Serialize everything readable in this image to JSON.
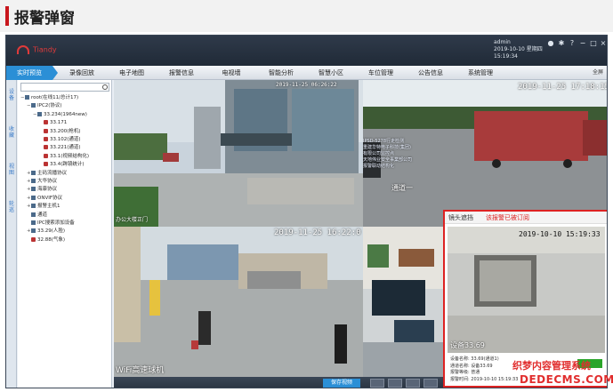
{
  "article": {
    "heading": "报警弹窗"
  },
  "app": {
    "logo_text": "Tiandy",
    "user_name": "admin",
    "date": "2019-10-10 星期四",
    "clock": "15:19:34",
    "menu": [
      {
        "label": "实时预览",
        "active": true
      },
      {
        "label": "录像回放"
      },
      {
        "label": "电子地图"
      },
      {
        "label": "报警信息"
      },
      {
        "label": "电视墙"
      },
      {
        "label": "智能分析"
      },
      {
        "label": "智慧小区"
      },
      {
        "label": "车位管理"
      },
      {
        "label": "公告信息"
      },
      {
        "label": "系统管理"
      }
    ],
    "menu_right": "全屏",
    "vtabs": [
      "设备",
      "收藏",
      "视图",
      "轮巡"
    ],
    "tree": [
      {
        "label": "root(在线11/总计17)",
        "indent": 0,
        "type": "dev",
        "exp": "−"
      },
      {
        "label": "IPC2(协议)",
        "indent": 1,
        "type": "dev",
        "exp": "−"
      },
      {
        "label": "33.234(1964new)",
        "indent": 2,
        "type": "dev",
        "exp": "−"
      },
      {
        "label": "33.171",
        "indent": 3,
        "type": "cam"
      },
      {
        "label": "33.200(枪机)",
        "indent": 3,
        "type": "cam"
      },
      {
        "label": "33.102(通道)",
        "indent": 3,
        "type": "cam"
      },
      {
        "label": "33.221(通道)",
        "indent": 3,
        "type": "cam"
      },
      {
        "label": "33.1(视频结构化)",
        "indent": 3,
        "type": "cam"
      },
      {
        "label": "33.4(跨镜统计)",
        "indent": 3,
        "type": "cam"
      },
      {
        "label": "主码流播协议",
        "indent": 1,
        "type": "dev",
        "exp": "+"
      },
      {
        "label": "大华协议",
        "indent": 1,
        "type": "dev",
        "exp": "+"
      },
      {
        "label": "海康协议",
        "indent": 1,
        "type": "dev",
        "exp": "+"
      },
      {
        "label": "ONVIF协议",
        "indent": 1,
        "type": "dev",
        "exp": "+"
      },
      {
        "label": "报警主机1",
        "indent": 1,
        "type": "dev",
        "exp": "+"
      },
      {
        "label": "通道",
        "indent": 1,
        "type": "dev"
      },
      {
        "label": "IPC搜索添加设备",
        "indent": 1,
        "type": "dev"
      },
      {
        "label": "33.29(人脸)",
        "indent": 1,
        "type": "dev",
        "exp": "+"
      },
      {
        "label": "32.88(气象)",
        "indent": 1,
        "type": "cam"
      }
    ],
    "tiles": {
      "t1_time": "2019-11-25 06:26:22",
      "t1_label": "办公大楼正门",
      "t2_time": "2019-11-25 17:18:15",
      "t3_time": "2019-11-25 16:22:0",
      "t3_label": "WiFi高速球机",
      "t4_label": "通道一",
      "t4_overlay": "IPSD-5278行走检测\n重建华特电子科技(集团)\n有限公司监控点\n天地伟业安全事業部公司\n报警联动结构化"
    },
    "alarm": {
      "title": "镜头遮挡",
      "status": "该报警已被订阅",
      "time": "2019-10-10 15:19:33",
      "overlay": "设备33.69",
      "info": [
        "设备名称: 33.69(通道1)",
        "通道名称: 设备33.69",
        "报警等级: 普通",
        "报警时间: 2019-10-10 15:19:33"
      ]
    },
    "toolbar": {
      "save_label": "保存视频"
    }
  },
  "watermark": {
    "line1": "织梦内容管理系统",
    "line2": "DEDECMS.COM"
  }
}
